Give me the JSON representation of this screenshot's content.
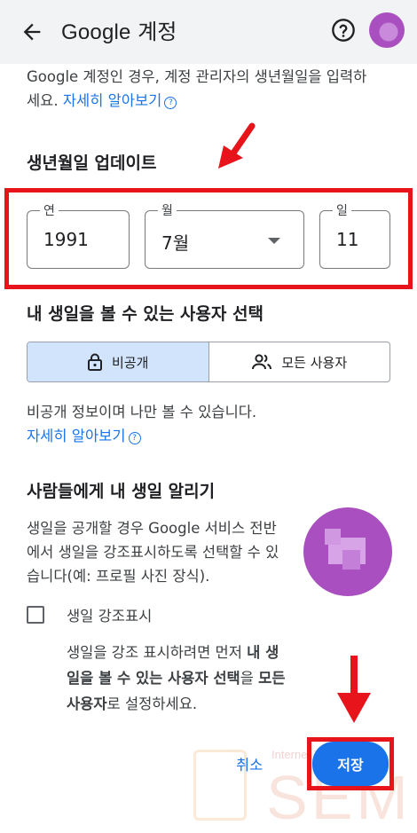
{
  "appbar": {
    "title_brand": "Google",
    "title_suffix": " 계정"
  },
  "intro": {
    "line1": "Google 계정인 경우, 계정 관리자의 생년월일을 입력하",
    "line2": "세요.",
    "link": "자세히 알아보기"
  },
  "birthday": {
    "heading": "생년월일 업데이트",
    "year": {
      "label": "연",
      "value": "1991"
    },
    "month": {
      "label": "월",
      "value": "7월"
    },
    "day": {
      "label": "일",
      "value": "11"
    }
  },
  "visibility": {
    "heading": "내 생일을 볼 수 있는 사용자 선택",
    "options": [
      {
        "label": "비공개",
        "icon": "lock-icon",
        "selected": true
      },
      {
        "label": "모든 사용자",
        "icon": "people-icon",
        "selected": false
      }
    ],
    "note": "비공개 정보이며 나만 볼 수 있습니다.",
    "link": "자세히 알아보기"
  },
  "share": {
    "heading": "사람들에게 내 생일 알리기",
    "desc1": "생일을 공개할 경우 Google 서비스 전반",
    "desc2": "에서 생일을 강조표시하도록 선택할 수 있",
    "desc3": "습니다(예: 프로필 사진 장식).",
    "checkbox_label": "생일 강조표시",
    "checkbox_checked": false,
    "hint_a": "생일을 강조 표시하려면 먼저 ",
    "hint_b": "내 생",
    "hint_c": "일을 볼 수 있는 사용자 선택",
    "hint_d": "을 ",
    "hint_e": "모든",
    "hint_f": "사용자",
    "hint_g": "로 설정하세요."
  },
  "actions": {
    "cancel": "취소",
    "save": "저장"
  },
  "watermark": {
    "small": "Internet Technology",
    "big": "SEM"
  },
  "colors": {
    "accent": "#1a73e8",
    "annotation_red": "#e8141b",
    "selected_segment": "#d2e3fc"
  }
}
